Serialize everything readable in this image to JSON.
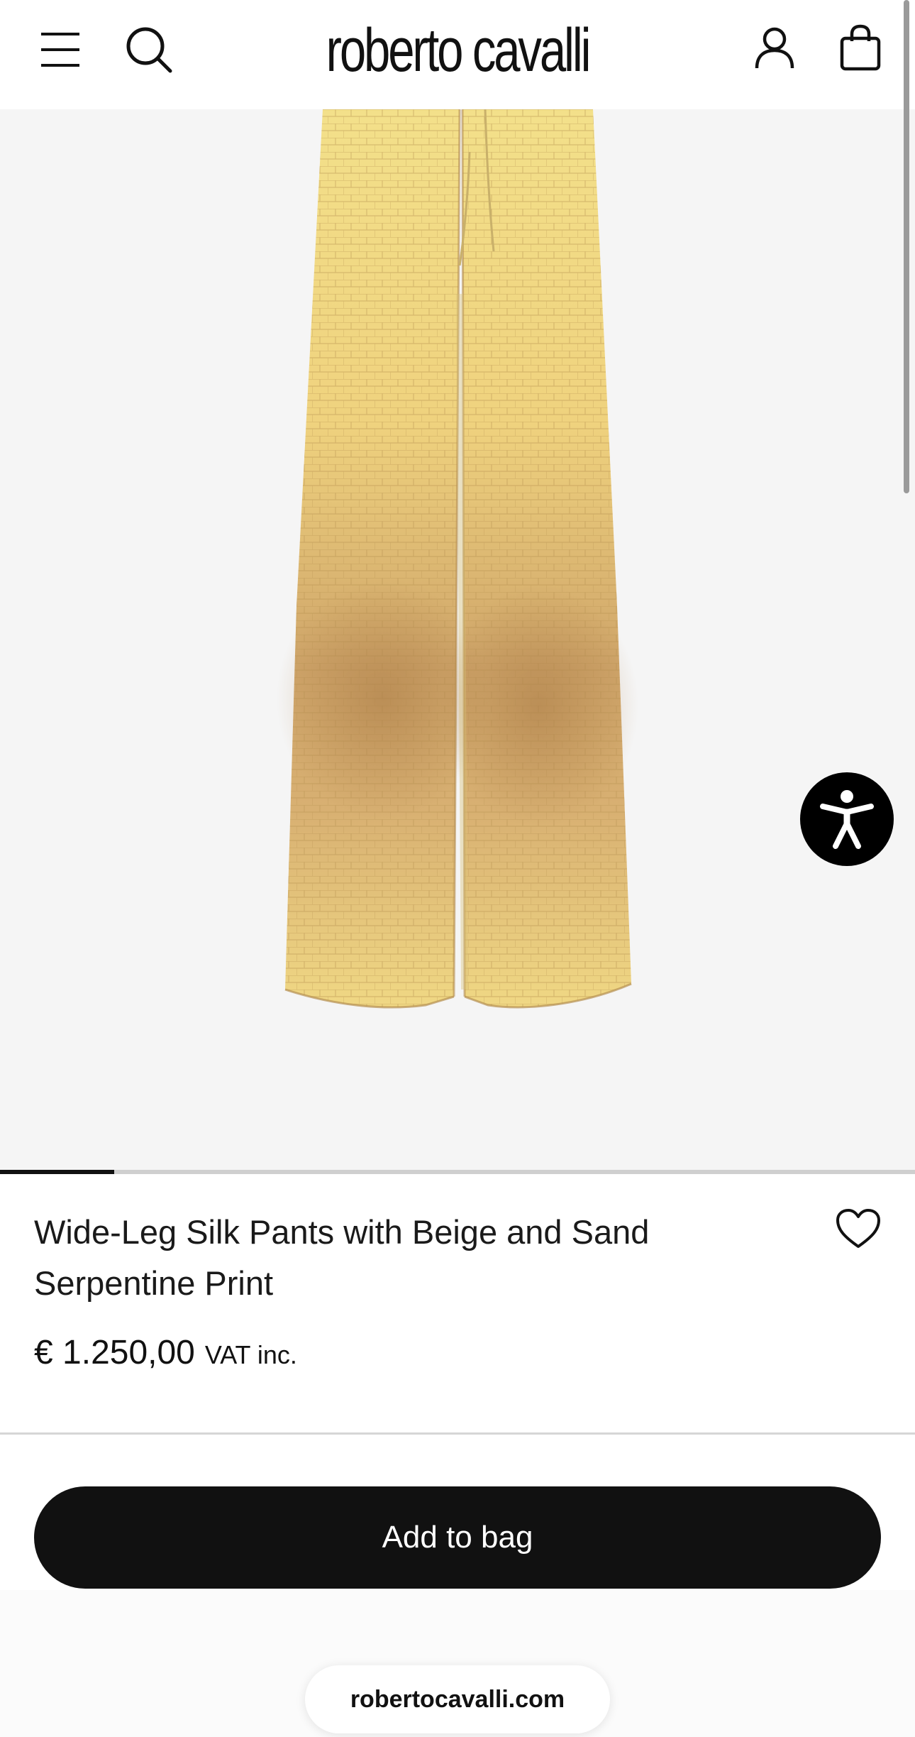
{
  "header": {
    "brand": "roberto cavalli",
    "menu_icon": "hamburger-menu-icon",
    "search_icon": "search-icon",
    "account_icon": "user-account-icon",
    "bag_icon": "shopping-bag-icon"
  },
  "gallery": {
    "image_subject": "wide-leg yellow crocodile-print silk pants",
    "current_slide_fraction": 0.125
  },
  "product": {
    "title": "Wide-Leg Silk Pants with Beige and Sand Serpentine Print",
    "price": "€ 1.250,00",
    "vat_note": "VAT inc.",
    "wishlist_icon": "heart-icon"
  },
  "actions": {
    "add_to_bag_label": "Add to bag"
  },
  "accessibility": {
    "icon": "accessibility-person-icon"
  },
  "browser": {
    "domain": "robertocavalli.com"
  },
  "colors": {
    "primary": "#111111",
    "background": "#f5f5f5",
    "fabric_light": "#f1dc86",
    "fabric_dark": "#c79d62"
  }
}
